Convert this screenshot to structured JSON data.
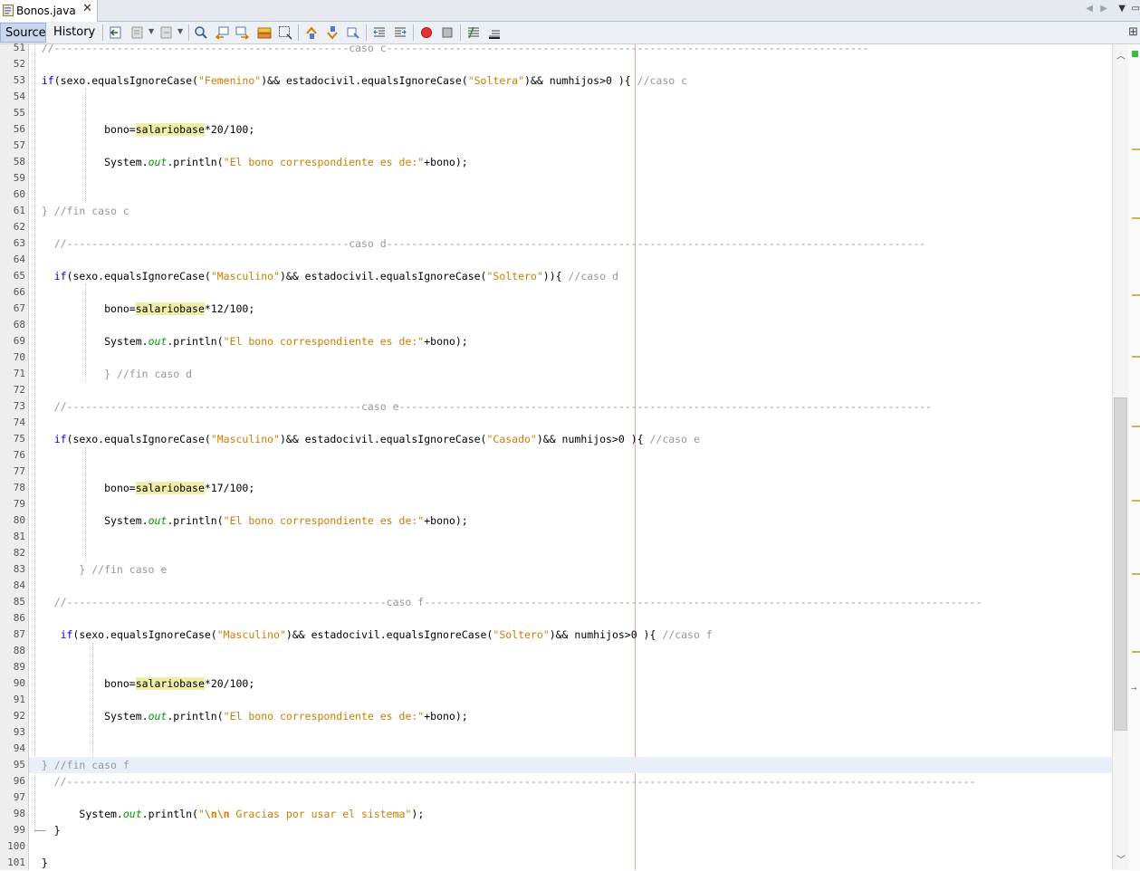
{
  "tab": {
    "title": "Bonos.java",
    "close": "✕"
  },
  "tabnav": {
    "left": "◀",
    "right": "▶",
    "down": "▼",
    "max": "▭"
  },
  "toolbar": {
    "source": "Source",
    "history": "History",
    "expand": "⊞"
  },
  "colors": {
    "keyword": "#0000e6",
    "string": "#ce7b00",
    "comment": "#969696",
    "static_field": "#009900",
    "highlight": "#eeeea8",
    "margin_line": "#f2a3a3",
    "breakpoint": "#e53333"
  },
  "icons": [
    "back-icon",
    "history-icon",
    "forward-icon",
    "find-icon",
    "find-previous-icon",
    "find-next-icon",
    "toggle-highlight-icon",
    "toggle-rect-select-icon",
    "previous-bookmark-icon",
    "next-bookmark-icon",
    "toggle-bookmark-icon",
    "shift-left-icon",
    "shift-right-icon",
    "start-macro-icon",
    "stop-macro-icon",
    "comment-icon",
    "uncomment-icon"
  ],
  "code": {
    "line_numbers": [
      "51",
      "52",
      "53",
      "54",
      "55",
      "56",
      "57",
      "58",
      "59",
      "60",
      "61",
      "62",
      "63",
      "64",
      "65",
      "66",
      "67",
      "68",
      "69",
      "70",
      "71",
      "72",
      "73",
      "74",
      "75",
      "76",
      "77",
      "78",
      "79",
      "80",
      "81",
      "82",
      "83",
      "84",
      "85",
      "86",
      "87",
      "88",
      "89",
      "90",
      "91",
      "92",
      "93",
      "94",
      "95",
      "96",
      "97",
      "98",
      "99",
      "100",
      "101"
    ],
    "s_femenino": "\"Femenino\"",
    "s_soltera": "\"Soltera\"",
    "s_masculino": "\"Masculino\"",
    "s_soltero": "\"Soltero\"",
    "s_casado": "\"Casado\"",
    "s_bono_msg": "\"El bono correspondiente es de:\"",
    "s_gracias_open": "\"",
    "s_gracias_esc": "\\n\\n",
    "s_gracias_rest": " Gracias por usar el sistema\"",
    "kw_if": "if",
    "cond_sexo": "(sexo.equalsIgnoreCase(",
    "cond_and_estado": ")&& estadocivil.equalsIgnoreCase(",
    "cond_numhijos": ")&& numhijos>0 ){ ",
    "cond_close_d": ")){ ",
    "bono_assign": "bono=",
    "salariobase": "salariobase",
    "pct20": "*20/100;",
    "pct12": "*12/100;",
    "pct17": "*17/100;",
    "system": "System.",
    "out": "out",
    "println_open": ".println(",
    "println_bono_close": "+bono);",
    "println_close": ");",
    "c_caso_c_top": "//-----------------------------------------------caso c-----------------------------------------------------------------------------",
    "c_caso_c": "//caso c",
    "c_fin_c": "} //fin caso c",
    "c_sep_d": "//---------------------------------------------caso d--------------------------------------------------------------------------------------",
    "c_caso_d": "//caso d",
    "c_fin_d": "} //fin caso d",
    "c_sep_e": "//-----------------------------------------------caso e-------------------------------------------------------------------------------------",
    "c_caso_e": "//caso e",
    "c_fin_e": "} //fin caso e",
    "c_sep_f": "//---------------------------------------------------caso f-----------------------------------------------------------------------------------------",
    "c_caso_f": "//caso f",
    "c_fin_f": "} //fin caso f",
    "c_sep_end": "//-------------------------------------------------------------------------------------------------------------------------------------------------",
    "brace": "}"
  }
}
